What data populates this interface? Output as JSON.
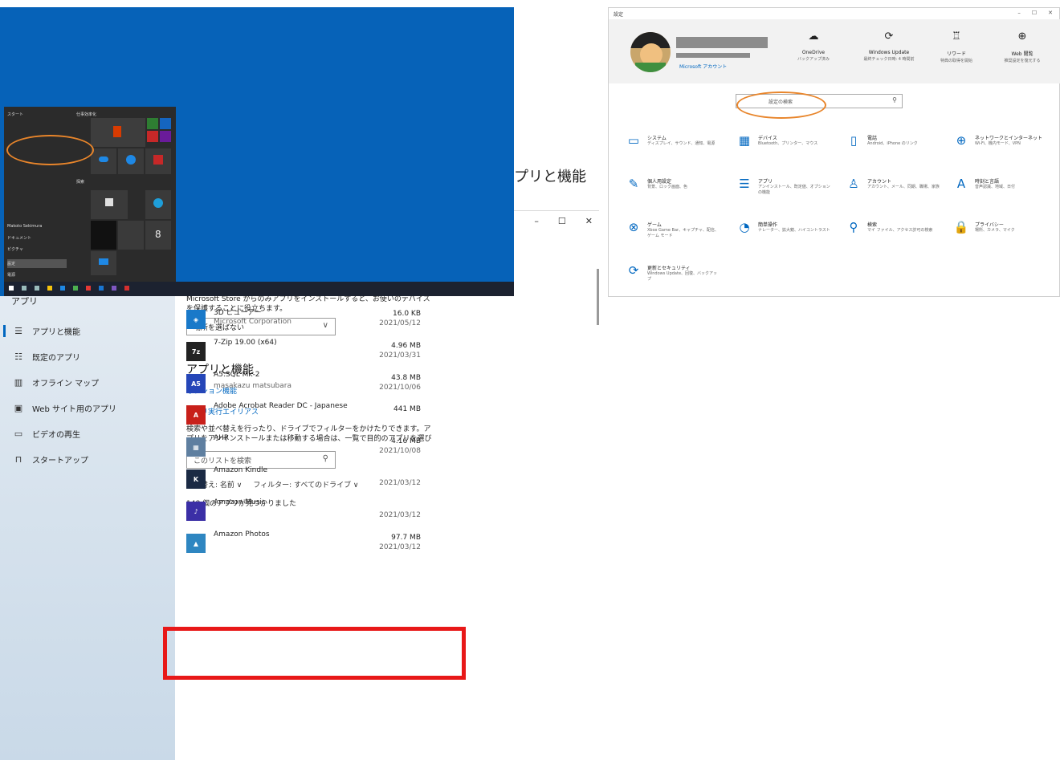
{
  "colors": {
    "accent": "#0067c0",
    "highlight": "#e81818",
    "annotation": "#e8852b",
    "desktop": "#0662b8"
  },
  "apps_window": {
    "window_controls": [
      "–",
      "☐",
      "✕"
    ],
    "sidebar_title": "アプリ",
    "nav": [
      {
        "label": "アプリと機能",
        "icon": "list-icon",
        "glyph": "☰"
      },
      {
        "label": "既定のアプリ",
        "icon": "default-apps-icon",
        "glyph": "☷"
      },
      {
        "label": "オフライン マップ",
        "icon": "map-icon",
        "glyph": "▥"
      },
      {
        "label": "Web サイト用のアプリ",
        "icon": "web-apps-icon",
        "glyph": "▣"
      },
      {
        "label": "ビデオの再生",
        "icon": "video-icon",
        "glyph": "▭"
      },
      {
        "label": "スタートアップ",
        "icon": "startup-icon",
        "glyph": "⊓"
      }
    ],
    "store_note": "Microsoft Store からのみアプリをインストールすると、お使いのデバイスを保護することに役立ちます。",
    "location_select": "場所を選ばない",
    "heading": "アプリと機能",
    "optional_features": "オプション機能",
    "app_execution_alias": "アプリ実行エイリアス",
    "filter_desc": "検索や並べ替えを行ったり、ドライブでフィルターをかけたりできます。アプリをアンインストールまたは移動する場合は、一覧で目的のアプリを選びます。",
    "search_placeholder": "このリストを検索",
    "sort_label": "並べ替え: 名前 ∨",
    "filter_label": "フィルター: すべてのドライブ ∨",
    "count": "148 個のアプリが見つかりました",
    "apps": [
      {
        "name": "3D ビューアー",
        "publisher": "Microsoft Corporation",
        "size": "16.0 KB",
        "date": "2021/05/12",
        "icon_bg": "#1979c9",
        "icon_text": "◈"
      },
      {
        "name": "7-Zip 19.00 (x64)",
        "publisher": "",
        "size": "4.96 MB",
        "date": "2021/03/31",
        "icon_bg": "#222222",
        "icon_text": "7z"
      },
      {
        "name": "A5:SQL Mk-2",
        "publisher": "masakazu matsubara",
        "size": "43.8 MB",
        "date": "2021/10/06",
        "icon_bg": "#2546b8",
        "icon_text": "A5"
      },
      {
        "name": "Adobe Acrobat Reader DC - Japanese",
        "publisher": "",
        "size": "441 MB",
        "date": "",
        "icon_bg": "#c8201a",
        "icon_text": "A"
      },
      {
        "name": "AHR",
        "publisher": "",
        "size": "4.16 MB",
        "date": "2021/10/08",
        "icon_bg": "#5f7fa0",
        "icon_text": "▦"
      },
      {
        "name": "Amazon Kindle",
        "publisher": "",
        "size": "",
        "date": "2021/03/12",
        "icon_bg": "#1b2a44",
        "icon_text": "K"
      },
      {
        "name": "Amazon Music",
        "publisher": "",
        "size": "",
        "date": "2021/03/12",
        "icon_bg": "#3b2fa6",
        "icon_text": "♪"
      },
      {
        "name": "Amazon Photos",
        "publisher": "",
        "size": "97.7 MB",
        "date": "2021/03/12",
        "icon_bg": "#2e86c1",
        "icon_text": "▲"
      }
    ]
  },
  "start_menu": {
    "left_items": [
      "スタート",
      "Makoto Sekimura",
      "ドキュメント",
      "ピクチャ",
      "設定",
      "電源"
    ],
    "tile_header": "仕事効率化",
    "tile_header2": "探索",
    "calendar_day": "8"
  },
  "partial_text": "プリと機能",
  "settings_window": {
    "title": "設定",
    "window_controls": [
      "–",
      "☐",
      "✕"
    ],
    "account_link": "Microsoft アカウント",
    "quick_links": [
      {
        "title": "OneDrive",
        "sub": "バックアップ済み",
        "icon": "cloud-icon",
        "glyph": "☁"
      },
      {
        "title": "Windows Update",
        "sub": "最終チェック日時: 4 時間前",
        "icon": "update-icon",
        "glyph": "⟳"
      },
      {
        "title": "リワード",
        "sub": "特典の取得を開始",
        "icon": "rewards-icon",
        "glyph": "♖"
      },
      {
        "title": "Web 閲覧",
        "sub": "推奨設定を復元する",
        "icon": "globe-icon",
        "glyph": "⊕"
      }
    ],
    "search_placeholder": "設定の検索",
    "categories": [
      {
        "name": "システム",
        "desc": "ディスプレイ、サウンド、通知、電源",
        "icon": "laptop-icon",
        "glyph": "▭"
      },
      {
        "name": "デバイス",
        "desc": "Bluetooth、プリンター、マウス",
        "icon": "devices-icon",
        "glyph": "▦"
      },
      {
        "name": "電話",
        "desc": "Android、iPhone のリンク",
        "icon": "phone-icon",
        "glyph": "▯"
      },
      {
        "name": "ネットワークとインターネット",
        "desc": "Wi-Fi、機内モード、VPN",
        "icon": "network-icon",
        "glyph": "⊕"
      },
      {
        "name": "個人用設定",
        "desc": "背景、ロック画面、色",
        "icon": "personalization-icon",
        "glyph": "✎"
      },
      {
        "name": "アプリ",
        "desc": "アンインストール、既定値、オプションの機能",
        "icon": "apps-icon",
        "glyph": "☰"
      },
      {
        "name": "アカウント",
        "desc": "アカウント、メール、同期、職場、家族",
        "icon": "account-icon",
        "glyph": "♙"
      },
      {
        "name": "時刻と言語",
        "desc": "音声認識、地域、日付",
        "icon": "time-language-icon",
        "glyph": "A"
      },
      {
        "name": "ゲーム",
        "desc": "Xbox Game Bar、キャプチャ、配信、ゲーム モード",
        "icon": "xbox-icon",
        "glyph": "⊗"
      },
      {
        "name": "簡単操作",
        "desc": "ナレーター、拡大鏡、ハイコントラスト",
        "icon": "ease-of-access-icon",
        "glyph": "◔"
      },
      {
        "name": "検索",
        "desc": "マイ ファイル、アクセス許可の検索",
        "icon": "search-icon",
        "glyph": "⚲"
      },
      {
        "name": "プライバシー",
        "desc": "場所、カメラ、マイク",
        "icon": "lock-icon",
        "glyph": "🔒"
      },
      {
        "name": "更新とセキュリティ",
        "desc": "Windows Update、回復、バックアップ",
        "icon": "sync-icon",
        "glyph": "⟳"
      }
    ]
  }
}
